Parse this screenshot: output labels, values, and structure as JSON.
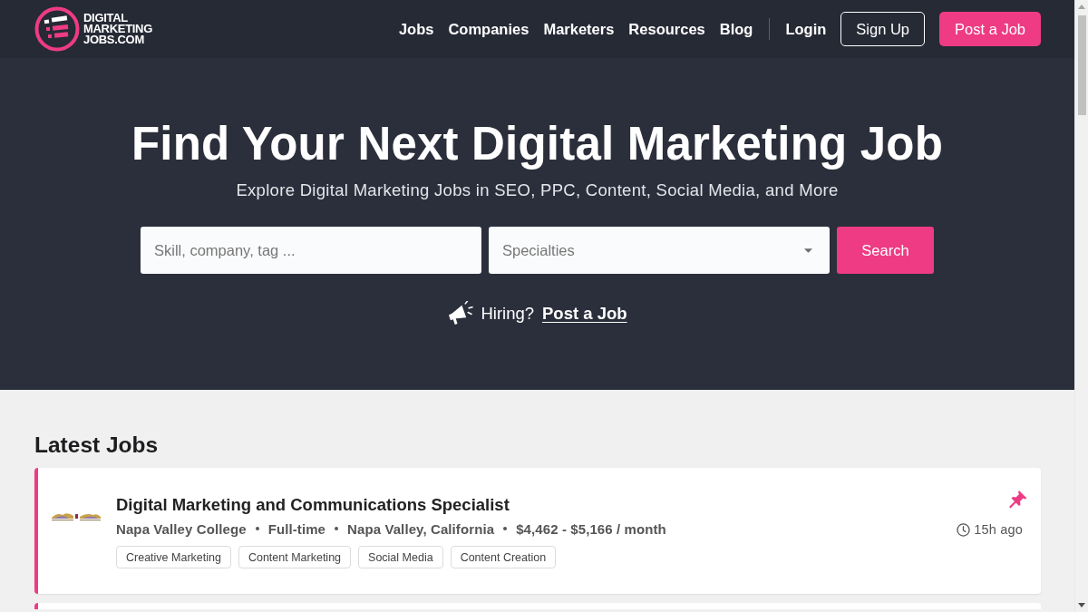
{
  "header": {
    "logo_lines": [
      "DIGITAL",
      "MARKETING",
      "JOBS.COM"
    ],
    "nav": [
      {
        "label": "Jobs"
      },
      {
        "label": "Companies"
      },
      {
        "label": "Marketers"
      },
      {
        "label": "Resources"
      },
      {
        "label": "Blog"
      }
    ],
    "login": "Login",
    "sign_up": "Sign Up",
    "post_job": "Post a Job"
  },
  "hero": {
    "title": "Find Your Next Digital Marketing Job",
    "subtitle": "Explore Digital Marketing Jobs in SEO, PPC, Content, Social Media, and More",
    "search": {
      "placeholder": "Skill, company, tag ..."
    },
    "specialties": {
      "placeholder": "Specialties"
    },
    "search_button": "Search",
    "hiring": {
      "text": "Hiring?",
      "link": "Post a Job"
    }
  },
  "latest_jobs": {
    "heading": "Latest Jobs",
    "jobs": [
      {
        "title": "Digital Marketing and Communications Specialist",
        "meta": {
          "company": "Napa Valley College",
          "type": "Full-time",
          "location": "Napa Valley, California",
          "salary": "$4,462 - $5,166 / month"
        },
        "tags": [
          "Creative Marketing",
          "Content Marketing",
          "Social Media",
          "Content Creation"
        ],
        "posted": "15h ago",
        "pinned": true
      }
    ]
  }
}
